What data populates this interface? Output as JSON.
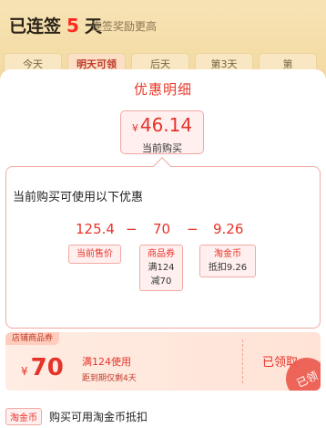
{
  "checkin": {
    "title_prefix": "已连签",
    "days_count": "5",
    "title_suffix": "天",
    "subtitle": "连签奖励更高",
    "days": [
      "今天",
      "明天可领",
      "后天",
      "第3天",
      "第"
    ]
  },
  "detail": {
    "title": "优惠明细",
    "current_price": {
      "currency": "¥",
      "amount": "46.14",
      "caption": "当前购买"
    },
    "calc_heading": "当前购买可使用以下优惠",
    "equation": {
      "price": "125.4",
      "minus1": "−",
      "coupon": "70",
      "minus2": "−",
      "coins": "9.26"
    },
    "tags": {
      "price_label": "当前售价",
      "coupon_label": "商品券",
      "coupon_line1": "满124",
      "coupon_line2": "减70",
      "coin_label": "淘金币",
      "coin_line": "抵扣9.26"
    }
  },
  "coupon": {
    "badge": "店铺商品券",
    "currency": "¥",
    "amount": "70",
    "condition": "满124使用",
    "expiry": "距到期仅剩4天",
    "status": "已领取",
    "stamp": "已领"
  },
  "coin_row": {
    "tag": "淘金币",
    "text": "购买可用淘金币抵扣"
  }
}
